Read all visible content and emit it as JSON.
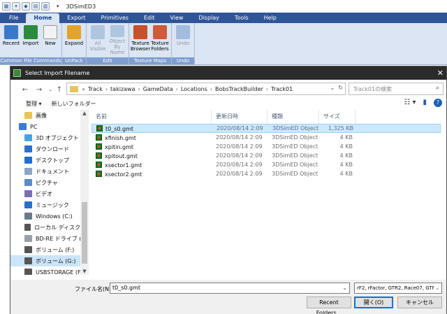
{
  "app": {
    "title": "3DSimED3"
  },
  "menu_tabs": [
    "File",
    "Home",
    "Export",
    "Primitives",
    "Edit",
    "View",
    "Display",
    "Tools",
    "Help"
  ],
  "active_tab": "Home",
  "ribbon": {
    "groups": [
      {
        "label": "Common File Commands",
        "buttons": [
          {
            "label": "Recent",
            "icon": "recent-icon",
            "disabled": false
          },
          {
            "label": "Import",
            "icon": "import-icon",
            "disabled": false
          },
          {
            "label": "New",
            "icon": "new-file-icon",
            "disabled": false
          }
        ]
      },
      {
        "label": "UnPack",
        "buttons": [
          {
            "label": "Expand",
            "icon": "expand-icon",
            "disabled": false
          }
        ]
      },
      {
        "label": "Edit",
        "buttons": [
          {
            "label": "All Visible",
            "icon": "all-visible-icon",
            "disabled": true
          },
          {
            "label": "Object By Name",
            "icon": "object-by-name-icon",
            "disabled": true
          }
        ]
      },
      {
        "label": "Texture Maps",
        "buttons": [
          {
            "label": "Texture Browser",
            "icon": "texture-browser-icon",
            "disabled": false
          },
          {
            "label": "Texture Folders",
            "icon": "texture-folders-icon",
            "disabled": false
          }
        ]
      },
      {
        "label": "Undo",
        "buttons": [
          {
            "label": "Undo",
            "icon": "undo-icon",
            "disabled": true
          }
        ]
      }
    ]
  },
  "dialog": {
    "title": "Select Import Filename",
    "address": {
      "prefix": "«",
      "crumbs": [
        "Track",
        "takizawa",
        "GameData",
        "Locations",
        "BobsTrackBuilder",
        "Track01"
      ]
    },
    "search_placeholder": "Track01の検索",
    "cmdbar": {
      "organize": "整理 ▾",
      "new_folder": "新しいフォルダー"
    },
    "nav_items": [
      {
        "label": "画像",
        "icon": "folder-icon",
        "color": "#e8c45a",
        "indent": 1
      },
      {
        "label": "PC",
        "icon": "pc-icon",
        "color": "#3a7bd5",
        "indent": 0
      },
      {
        "label": "3D オブジェクト",
        "icon": "3d-objects-icon",
        "color": "#4aa3df",
        "indent": 1
      },
      {
        "label": "ダウンロード",
        "icon": "download-icon",
        "color": "#2a6fc9",
        "indent": 1
      },
      {
        "label": "デスクトップ",
        "icon": "desktop-icon",
        "color": "#1e6fd0",
        "indent": 1
      },
      {
        "label": "ドキュメント",
        "icon": "documents-icon",
        "color": "#8aa4c4",
        "indent": 1
      },
      {
        "label": "ピクチャ",
        "icon": "pictures-icon",
        "color": "#5b8bc6",
        "indent": 1
      },
      {
        "label": "ビデオ",
        "icon": "videos-icon",
        "color": "#7a6fb0",
        "indent": 1
      },
      {
        "label": "ミュージック",
        "icon": "music-icon",
        "color": "#2a6fc9",
        "indent": 1
      },
      {
        "label": "Windows (C:)",
        "icon": "drive-icon",
        "color": "#6a7b8c",
        "indent": 1
      },
      {
        "label": "ローカル ディスク (D",
        "icon": "drive-icon",
        "color": "#555555",
        "indent": 1
      },
      {
        "label": "BD-RE ドライブ (E:",
        "icon": "disc-drive-icon",
        "color": "#9aa0a6",
        "indent": 1
      },
      {
        "label": "ボリューム (F:)",
        "icon": "drive-icon",
        "color": "#555555",
        "indent": 1
      },
      {
        "label": "ボリューム (G:)",
        "icon": "drive-icon",
        "color": "#555555",
        "indent": 1,
        "selected": true
      },
      {
        "label": "USBSTORAGE (F:",
        "icon": "usb-drive-icon",
        "color": "#555555",
        "indent": 1
      }
    ],
    "columns": {
      "name": "名前",
      "date": "更新日時",
      "type": "種類",
      "size": "サイズ"
    },
    "files": [
      {
        "name": "t0_s0.gmt",
        "date": "2020/08/14 2:09",
        "type": "3DSimED Object",
        "size": "1,325 KB",
        "selected": true
      },
      {
        "name": "xfinish.gmt",
        "date": "2020/08/14 2:09",
        "type": "3DSimED Object",
        "size": "4 KB"
      },
      {
        "name": "xpitin.gmt",
        "date": "2020/08/14 2:09",
        "type": "3DSimED Object",
        "size": "4 KB"
      },
      {
        "name": "xpitout.gmt",
        "date": "2020/08/14 2:09",
        "type": "3DSimED Object",
        "size": "4 KB"
      },
      {
        "name": "xsector1.gmt",
        "date": "2020/08/14 2:09",
        "type": "3DSimED Object",
        "size": "4 KB"
      },
      {
        "name": "xsector2.gmt",
        "date": "2020/08/14 2:09",
        "type": "3DSimED Object",
        "size": "4 KB"
      }
    ],
    "filename_label": "ファイル名(N):",
    "filename_value": "t0_s0.gmt",
    "filetype_value": "rF2, rFactor, GTR2, Race07, GTR,",
    "buttons": {
      "recent": "Recent Folders...",
      "open": "開く(O)",
      "cancel": "キャンセル"
    }
  },
  "colors": {
    "tab_bar": "#2f5597",
    "ribbon_bg": "#dbe5f3",
    "group_label": "#7d9ed0",
    "selection": "#cce8ff"
  }
}
